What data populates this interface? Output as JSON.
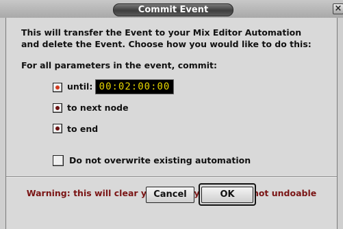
{
  "window": {
    "title": "Commit Event",
    "close_glyph": "×"
  },
  "description": {
    "line1": "This will transfer the Event to your Mix Editor Automation",
    "line2": "and delete the Event. Choose how you would like to do this:"
  },
  "params_label": "For all parameters in the event, commit:",
  "options": [
    {
      "label": "until:",
      "selected": true
    },
    {
      "label": "to next node",
      "selected": false
    },
    {
      "label": "to end",
      "selected": false
    }
  ],
  "timecode": "00:02:00:00",
  "overwrite_checkbox": {
    "label": "Do not overwrite existing automation",
    "checked": false
  },
  "warning": "Warning: this will clear your history list and is not undoable",
  "buttons": {
    "cancel": "Cancel",
    "ok": "OK"
  },
  "colors": {
    "warning": "#7a1414",
    "timecode_text": "#e8d800",
    "selected_radio": "#d43a1e"
  }
}
